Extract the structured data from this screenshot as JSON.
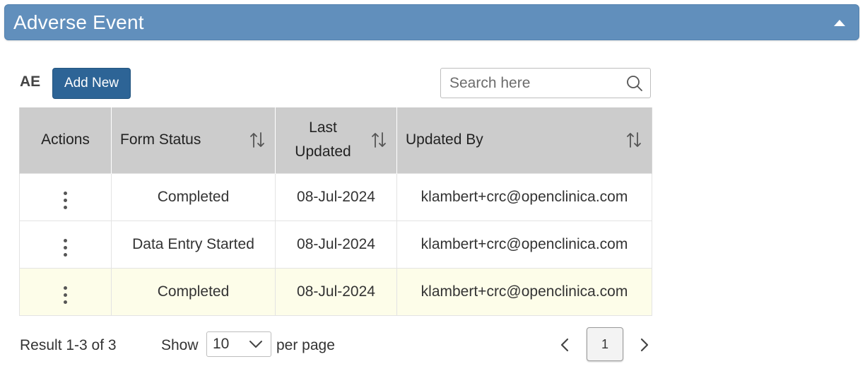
{
  "panel": {
    "title": "Adverse Event"
  },
  "toolbar": {
    "label": "AE",
    "add_label": "Add New"
  },
  "search": {
    "placeholder": "Search here"
  },
  "table": {
    "columns": [
      "Actions",
      "Form Status",
      "Last Updated",
      "Updated By"
    ],
    "rows": [
      {
        "status": "Completed",
        "last_updated": "08-Jul-2024",
        "updated_by": "klambert+crc@openclinica.com"
      },
      {
        "status": "Data Entry Started",
        "last_updated": "08-Jul-2024",
        "updated_by": "klambert+crc@openclinica.com"
      },
      {
        "status": "Completed",
        "last_updated": "08-Jul-2024",
        "updated_by": "klambert+crc@openclinica.com"
      }
    ]
  },
  "footer": {
    "result_text": "Result 1-3 of 3",
    "show_label": "Show",
    "page_size": "10",
    "per_page_label": "per page",
    "current_page": "1"
  },
  "colors": {
    "header_bg": "#618fbc",
    "button_bg": "#2d6496",
    "table_header_bg": "#cccccc",
    "highlight_row_bg": "#fdfde9"
  },
  "icons": {
    "collapse": "caret-up-icon",
    "search": "search-icon",
    "sort": "sort-icon",
    "row_actions": "kebab-menu-icon",
    "page_size_dropdown": "chevron-down-icon",
    "prev": "chevron-left-icon",
    "next": "chevron-right-icon"
  }
}
